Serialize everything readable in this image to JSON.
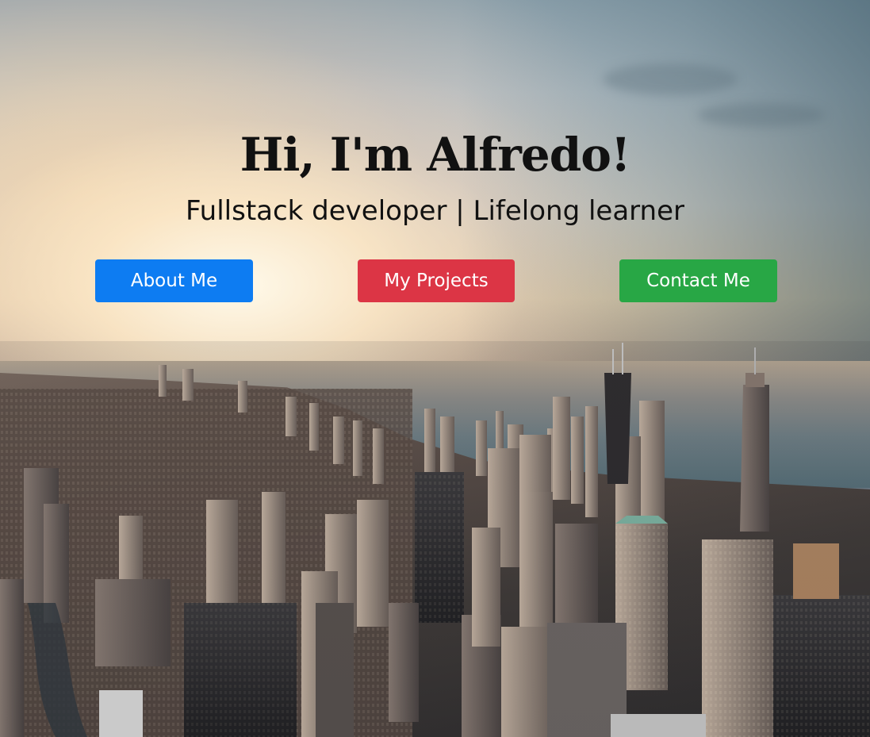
{
  "hero": {
    "title": "Hi, I'm Alfredo!",
    "subtitle": "Fullstack developer | Lifelong learner",
    "background": "city-skyline-photo"
  },
  "buttons": {
    "about": "About Me",
    "projects": "My Projects",
    "contact": "Contact Me"
  },
  "colors": {
    "about_button": "#0d7cf2",
    "projects_button": "#dc3545",
    "contact_button": "#28a745",
    "text": "#111111"
  }
}
